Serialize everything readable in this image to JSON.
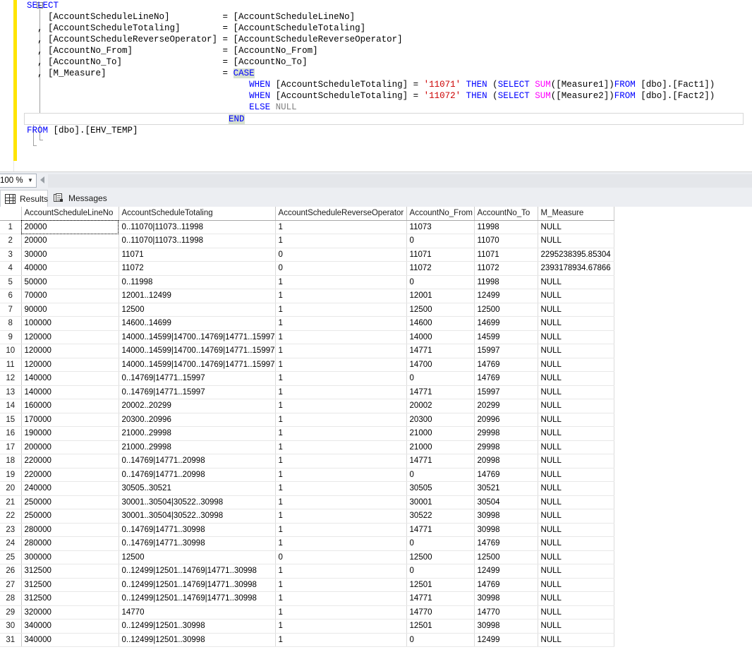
{
  "editor": {
    "code_lines": [
      [
        {
          "t": "SELECT",
          "c": "k"
        }
      ],
      [
        {
          "t": "    [AccountScheduleLineNo]          = [AccountScheduleLineNo]",
          "c": "pl"
        }
      ],
      [
        {
          "t": "  , [AccountScheduleTotaling]        = [AccountScheduleTotaling]",
          "c": "pl"
        }
      ],
      [
        {
          "t": "  , [AccountScheduleReverseOperator] = [AccountScheduleReverseOperator]",
          "c": "pl"
        }
      ],
      [
        {
          "t": "  , [AccountNo_From]                 = [AccountNo_From]",
          "c": "pl"
        }
      ],
      [
        {
          "t": "  , [AccountNo_To]                   = [AccountNo_To]",
          "c": "pl"
        }
      ],
      [
        {
          "t": "  , [M_Measure]                      = ",
          "c": "pl"
        },
        {
          "t": "CASE",
          "c": "kcase"
        }
      ],
      [
        {
          "t": "                                          ",
          "c": "pl"
        },
        {
          "t": "WHEN",
          "c": "k"
        },
        {
          "t": " [AccountScheduleTotaling] = ",
          "c": "pl"
        },
        {
          "t": "'11071'",
          "c": "str"
        },
        {
          "t": " ",
          "c": "pl"
        },
        {
          "t": "THEN",
          "c": "k"
        },
        {
          "t": " (",
          "c": "pl"
        },
        {
          "t": "SELECT",
          "c": "k"
        },
        {
          "t": " ",
          "c": "pl"
        },
        {
          "t": "SUM",
          "c": "fn"
        },
        {
          "t": "([Measure1])",
          "c": "pl"
        },
        {
          "t": "FROM",
          "c": "k"
        },
        {
          "t": " [dbo].[Fact1])",
          "c": "pl"
        }
      ],
      [
        {
          "t": "                                          ",
          "c": "pl"
        },
        {
          "t": "WHEN",
          "c": "k"
        },
        {
          "t": " [AccountScheduleTotaling] = ",
          "c": "pl"
        },
        {
          "t": "'11072'",
          "c": "str"
        },
        {
          "t": " ",
          "c": "pl"
        },
        {
          "t": "THEN",
          "c": "k"
        },
        {
          "t": " (",
          "c": "pl"
        },
        {
          "t": "SELECT",
          "c": "k"
        },
        {
          "t": " ",
          "c": "pl"
        },
        {
          "t": "SUM",
          "c": "fn"
        },
        {
          "t": "([Measure2])",
          "c": "pl"
        },
        {
          "t": "FROM",
          "c": "k"
        },
        {
          "t": " [dbo].[Fact2])",
          "c": "pl"
        }
      ],
      [
        {
          "t": "                                          ",
          "c": "pl"
        },
        {
          "t": "ELSE",
          "c": "k"
        },
        {
          "t": " ",
          "c": "pl"
        },
        {
          "t": "NULL",
          "c": "nul"
        }
      ],
      [
        {
          "t": "                                      ",
          "c": "pl"
        },
        {
          "t": "END",
          "c": "kcase"
        }
      ],
      [
        {
          "t": "FROM",
          "c": "k"
        },
        {
          "t": " [dbo].[EHV_TEMP]",
          "c": "pl"
        }
      ]
    ],
    "current_line_index": 10
  },
  "zoom_bar": {
    "zoom_value": "100 %",
    "zoom_arrow": "▼"
  },
  "tabs": [
    {
      "id": "results",
      "label": "Results",
      "icon": "grid-icon",
      "active": true
    },
    {
      "id": "messages",
      "label": "Messages",
      "icon": "messages-icon",
      "active": false
    }
  ],
  "grid": {
    "columns": [
      "AccountScheduleLineNo",
      "AccountScheduleTotaling",
      "AccountScheduleReverseOperator",
      "AccountNo_From",
      "AccountNo_To",
      "M_Measure"
    ],
    "null_text": "NULL",
    "selected_cell": {
      "row": 0,
      "col": 0
    },
    "rows": [
      {
        "n": "1",
        "v": [
          "20000",
          "0..11070|11073..11998",
          "1",
          "11073",
          "11998",
          "NULL"
        ]
      },
      {
        "n": "2",
        "v": [
          "20000",
          "0..11070|11073..11998",
          "1",
          "0",
          "11070",
          "NULL"
        ]
      },
      {
        "n": "3",
        "v": [
          "30000",
          "11071",
          "0",
          "11071",
          "11071",
          "2295238395.85304"
        ]
      },
      {
        "n": "4",
        "v": [
          "40000",
          "11072",
          "0",
          "11072",
          "11072",
          "2393178934.67866"
        ]
      },
      {
        "n": "5",
        "v": [
          "50000",
          "0..11998",
          "1",
          "0",
          "11998",
          "NULL"
        ]
      },
      {
        "n": "6",
        "v": [
          "70000",
          "12001..12499",
          "1",
          "12001",
          "12499",
          "NULL"
        ]
      },
      {
        "n": "7",
        "v": [
          "90000",
          "12500",
          "1",
          "12500",
          "12500",
          "NULL"
        ]
      },
      {
        "n": "8",
        "v": [
          "100000",
          "14600..14699",
          "1",
          "14600",
          "14699",
          "NULL"
        ]
      },
      {
        "n": "9",
        "v": [
          "120000",
          "14000..14599|14700..14769|14771..15997",
          "1",
          "14000",
          "14599",
          "NULL"
        ]
      },
      {
        "n": "10",
        "v": [
          "120000",
          "14000..14599|14700..14769|14771..15997",
          "1",
          "14771",
          "15997",
          "NULL"
        ]
      },
      {
        "n": "11",
        "v": [
          "120000",
          "14000..14599|14700..14769|14771..15997",
          "1",
          "14700",
          "14769",
          "NULL"
        ]
      },
      {
        "n": "12",
        "v": [
          "140000",
          "0..14769|14771..15997",
          "1",
          "0",
          "14769",
          "NULL"
        ]
      },
      {
        "n": "13",
        "v": [
          "140000",
          "0..14769|14771..15997",
          "1",
          "14771",
          "15997",
          "NULL"
        ]
      },
      {
        "n": "14",
        "v": [
          "160000",
          "20002..20299",
          "1",
          "20002",
          "20299",
          "NULL"
        ]
      },
      {
        "n": "15",
        "v": [
          "170000",
          "20300..20996",
          "1",
          "20300",
          "20996",
          "NULL"
        ]
      },
      {
        "n": "16",
        "v": [
          "190000",
          "21000..29998",
          "1",
          "21000",
          "29998",
          "NULL"
        ]
      },
      {
        "n": "17",
        "v": [
          "200000",
          "21000..29998",
          "1",
          "21000",
          "29998",
          "NULL"
        ]
      },
      {
        "n": "18",
        "v": [
          "220000",
          "0..14769|14771..20998",
          "1",
          "14771",
          "20998",
          "NULL"
        ]
      },
      {
        "n": "19",
        "v": [
          "220000",
          "0..14769|14771..20998",
          "1",
          "0",
          "14769",
          "NULL"
        ]
      },
      {
        "n": "20",
        "v": [
          "240000",
          "30505..30521",
          "1",
          "30505",
          "30521",
          "NULL"
        ]
      },
      {
        "n": "21",
        "v": [
          "250000",
          "30001..30504|30522..30998",
          "1",
          "30001",
          "30504",
          "NULL"
        ]
      },
      {
        "n": "22",
        "v": [
          "250000",
          "30001..30504|30522..30998",
          "1",
          "30522",
          "30998",
          "NULL"
        ]
      },
      {
        "n": "23",
        "v": [
          "280000",
          "0..14769|14771..30998",
          "1",
          "14771",
          "30998",
          "NULL"
        ]
      },
      {
        "n": "24",
        "v": [
          "280000",
          "0..14769|14771..30998",
          "1",
          "0",
          "14769",
          "NULL"
        ]
      },
      {
        "n": "25",
        "v": [
          "300000",
          "12500",
          "0",
          "12500",
          "12500",
          "NULL"
        ]
      },
      {
        "n": "26",
        "v": [
          "312500",
          "0..12499|12501..14769|14771..30998",
          "1",
          "0",
          "12499",
          "NULL"
        ]
      },
      {
        "n": "27",
        "v": [
          "312500",
          "0..12499|12501..14769|14771..30998",
          "1",
          "12501",
          "14769",
          "NULL"
        ]
      },
      {
        "n": "28",
        "v": [
          "312500",
          "0..12499|12501..14769|14771..30998",
          "1",
          "14771",
          "30998",
          "NULL"
        ]
      },
      {
        "n": "29",
        "v": [
          "320000",
          "14770",
          "1",
          "14770",
          "14770",
          "NULL"
        ]
      },
      {
        "n": "30",
        "v": [
          "340000",
          "0..12499|12501..30998",
          "1",
          "12501",
          "30998",
          "NULL"
        ]
      },
      {
        "n": "31",
        "v": [
          "340000",
          "0..12499|12501..30998",
          "1",
          "0",
          "12499",
          "NULL"
        ]
      }
    ]
  },
  "colors": {
    "keyword": "#0000ff",
    "function": "#ff00ff",
    "string": "#cc0000",
    "null_literal": "#808080",
    "null_cell_bg": "#fcfbe3",
    "change_bar": "#ffe400",
    "chrome_bg": "#eceef2"
  }
}
